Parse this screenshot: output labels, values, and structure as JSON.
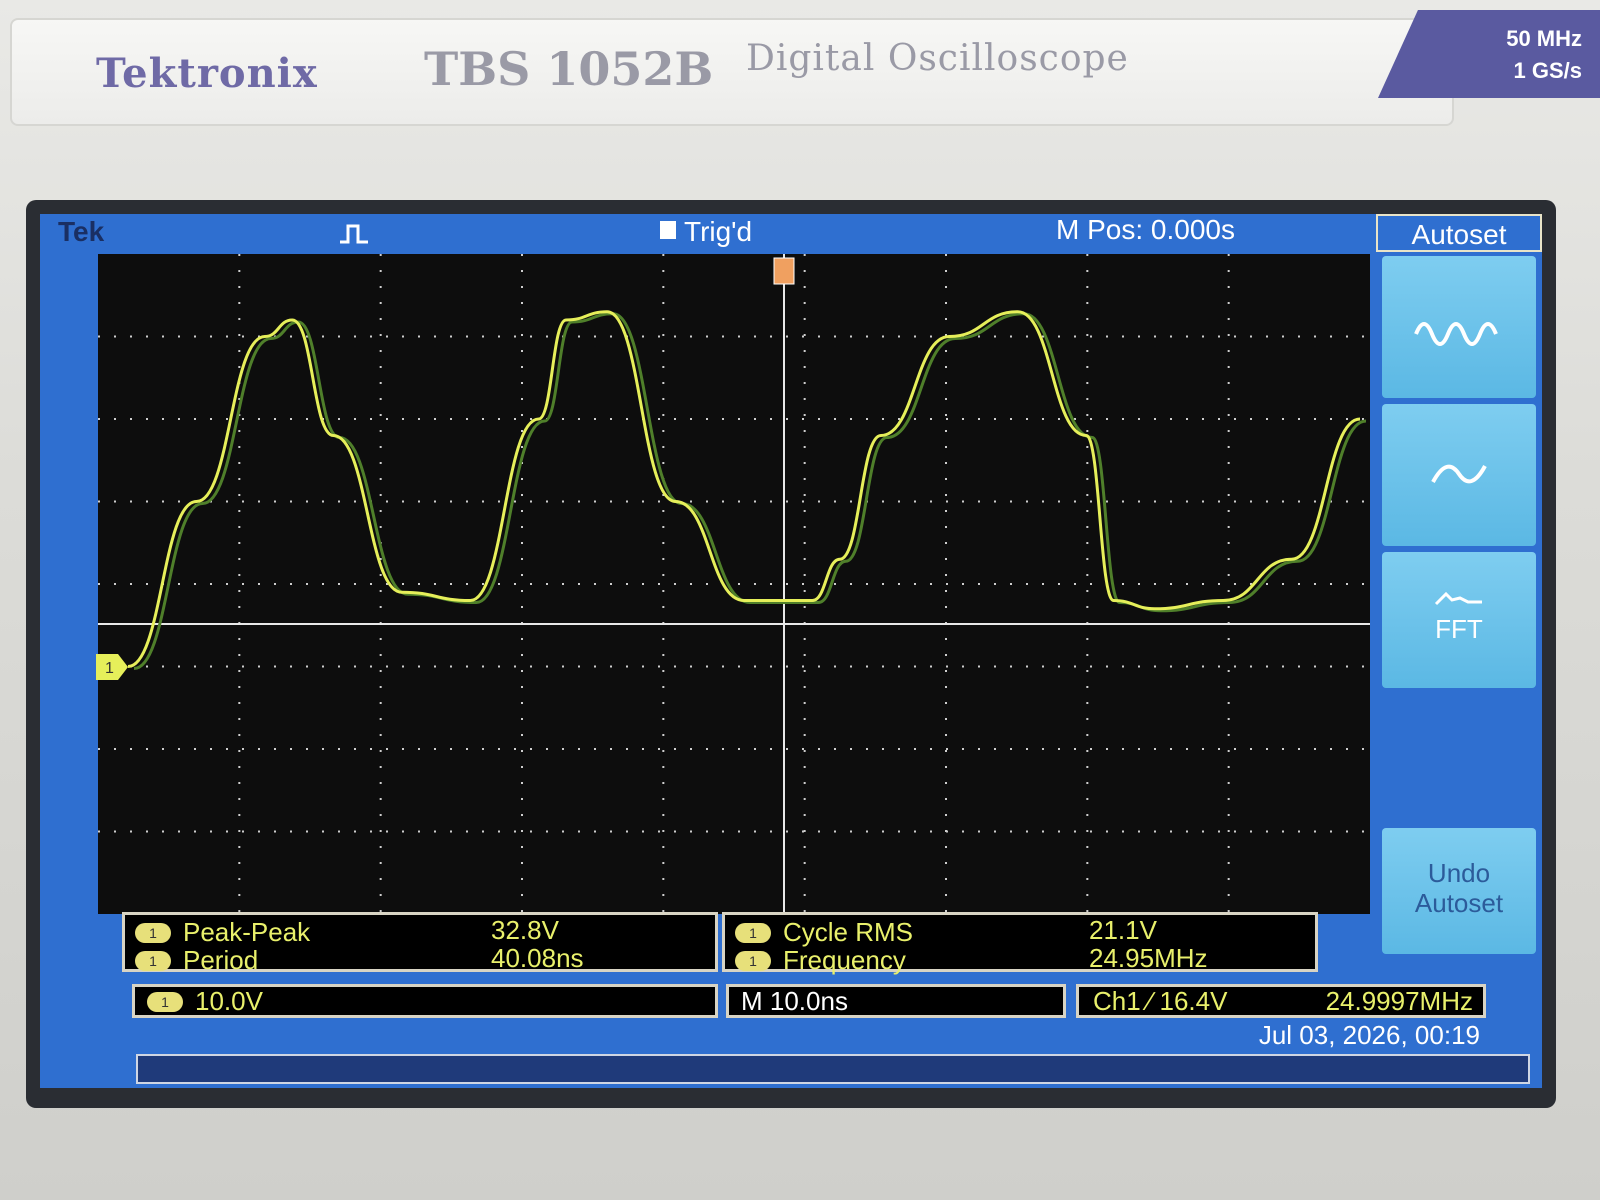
{
  "brand": "Tektronix",
  "model": "TBS 1052B",
  "model_desc": "Digital Oscilloscope",
  "spec": {
    "bandwidth": "50 MHz",
    "sample_rate": "1 GS/s"
  },
  "status": {
    "logo": "Tek",
    "trigger_state": "Trig'd",
    "position": "M Pos: 0.000s"
  },
  "menu": {
    "title": "Autoset",
    "fft_label": "FFT",
    "undo_label": "Undo Autoset",
    "icons": [
      "multi-cycle-wave-icon",
      "single-cycle-wave-icon",
      "fft-spectrum-icon"
    ]
  },
  "measurements": {
    "badge": "1",
    "left": [
      {
        "label": "Peak-Peak",
        "value": "32.8V"
      },
      {
        "label": "Period",
        "value": "40.08ns"
      }
    ],
    "right": [
      {
        "label": "Cycle RMS",
        "value": "21.1V"
      },
      {
        "label": "Frequency",
        "value": "24.95MHz"
      }
    ]
  },
  "info": {
    "ch1_scale": "10.0V",
    "timebase": "M 10.0ns",
    "trigger": "Ch1 ∕ 16.4V",
    "trigger_freq": "24.9997MHz"
  },
  "datetime": "Jul 03, 2026, 00:19",
  "ch1_marker": "1",
  "colors": {
    "trace": "#e6ef5a",
    "screen_blue": "#2f6fd0",
    "graticule": "#ffffff"
  },
  "chart_data": {
    "type": "line",
    "series": [
      {
        "x": [
          0,
          5,
          10,
          12,
          15,
          20,
          25,
          30,
          32,
          35,
          40,
          45,
          50,
          52,
          55,
          60,
          65,
          70,
          72,
          75,
          80,
          85,
          90
        ],
        "y": [
          -1.0,
          1.0,
          3.0,
          3.2,
          1.8,
          -0.1,
          -0.2,
          2.0,
          3.2,
          3.3,
          1.0,
          -0.2,
          -0.2,
          0.3,
          1.8,
          3.0,
          3.3,
          1.8,
          -0.2,
          -0.3,
          -0.2,
          0.3,
          2.0
        ]
      }
    ],
    "xlim": [
      0,
      90
    ],
    "ylim": [
      -4,
      4
    ],
    "grid": true
  }
}
